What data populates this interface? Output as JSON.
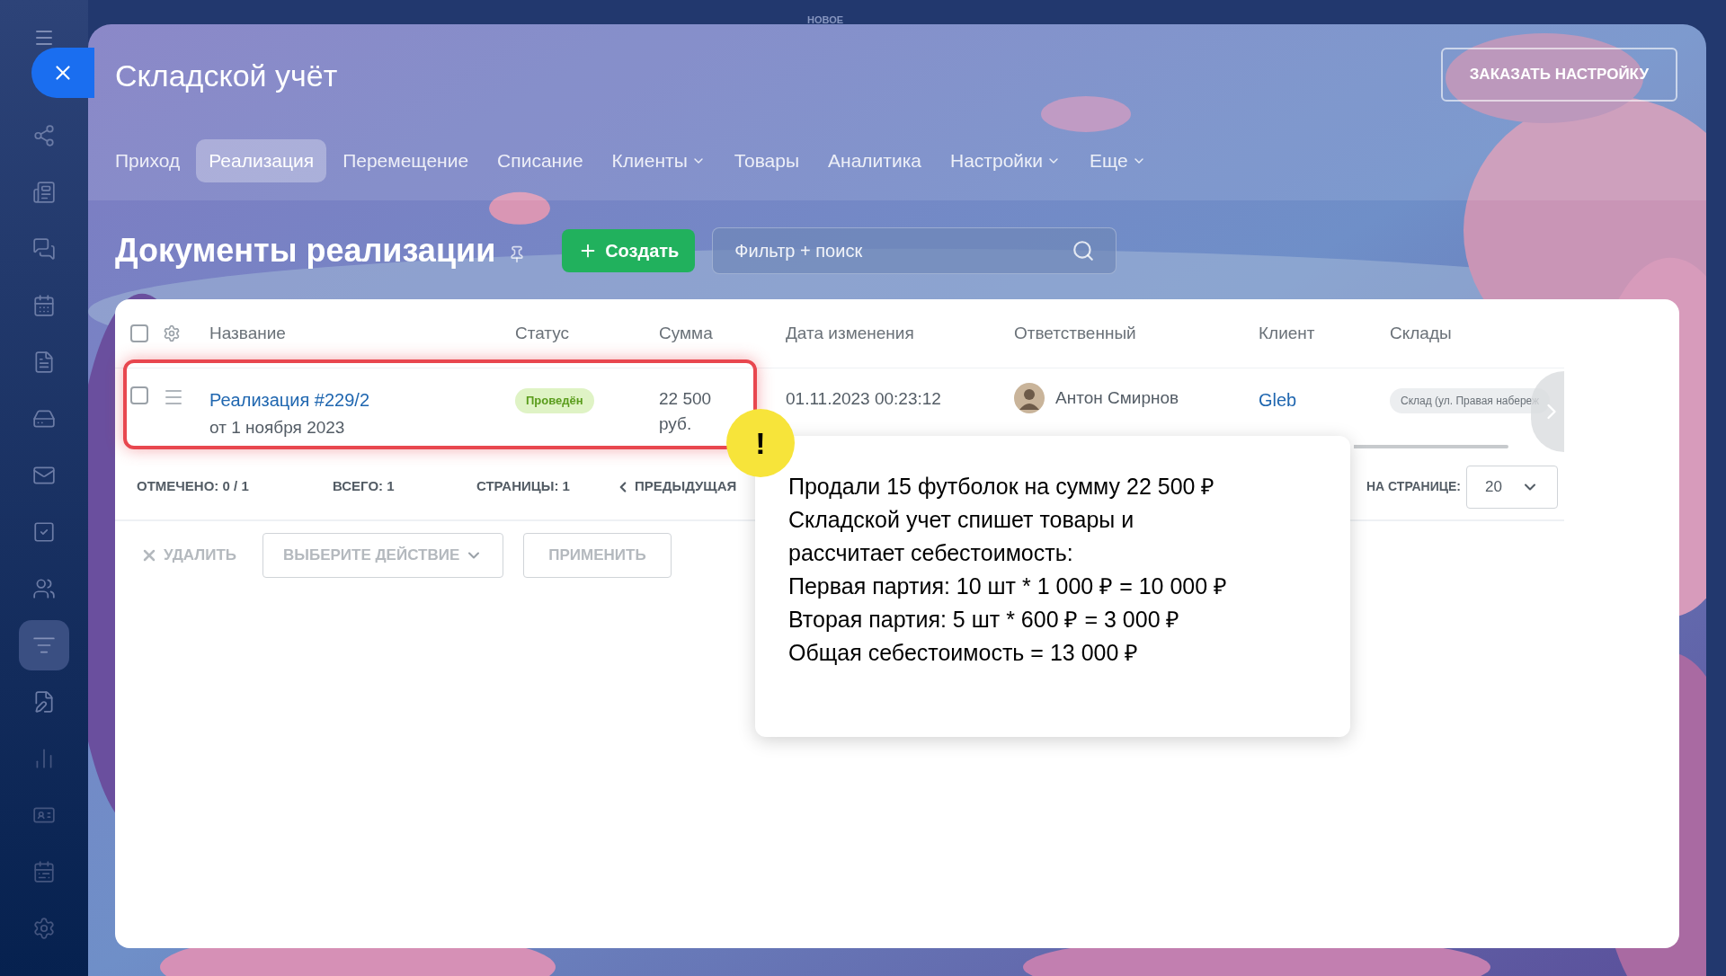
{
  "top_label": "НОВОЕ",
  "sidebar": {
    "items": [
      {
        "selected": false
      },
      {
        "selected": false
      },
      {
        "selected": false
      },
      {
        "selected": false
      },
      {
        "selected": false
      },
      {
        "selected": false
      },
      {
        "selected": false
      },
      {
        "selected": false
      },
      {
        "selected": false
      },
      {
        "selected": true
      },
      {
        "selected": false
      },
      {
        "selected": false
      },
      {
        "selected": false
      },
      {
        "selected": false
      },
      {
        "selected": false
      }
    ]
  },
  "window": {
    "title": "Складской учёт",
    "order_button": "ЗАКАЗАТЬ НАСТРОЙКУ"
  },
  "tabs": [
    {
      "label": "Приход",
      "selected": false,
      "has_menu": false
    },
    {
      "label": "Реализация",
      "selected": true,
      "has_menu": false
    },
    {
      "label": "Перемещение",
      "selected": false,
      "has_menu": false
    },
    {
      "label": "Списание",
      "selected": false,
      "has_menu": false
    },
    {
      "label": "Клиенты",
      "selected": false,
      "has_menu": true
    },
    {
      "label": "Товары",
      "selected": false,
      "has_menu": false
    },
    {
      "label": "Аналитика",
      "selected": false,
      "has_menu": false
    },
    {
      "label": "Настройки",
      "selected": false,
      "has_menu": true
    },
    {
      "label": "Еще",
      "selected": false,
      "has_menu": true
    }
  ],
  "page_heading": "Документы реализации",
  "create_button": "Создать",
  "search": {
    "placeholder": "Фильтр + поиск"
  },
  "table": {
    "all_checked": false,
    "columns": [
      "Название",
      "Статус",
      "Сумма",
      "Дата изменения",
      "Ответственный",
      "Клиент",
      "Склады"
    ],
    "rows": [
      {
        "checked": false,
        "name": "Реализация #229/2",
        "date_line": "от 1 ноября 2023",
        "status": "Проведён",
        "amount": "22 500 руб.",
        "modified": "01.11.2023 00:23:12",
        "responsible": "Антон Смирнов",
        "client": "Gleb",
        "warehouse": "Склад (ул. Правая набереж"
      }
    ]
  },
  "footer": {
    "checked_label": "ОТМЕЧЕНО:",
    "checked_value": "0 / 1",
    "total_label": "ВСЕГО:",
    "total_value": "1",
    "pages_label": "СТРАНИЦЫ:",
    "pages_value": "1",
    "prev": "ПРЕДЫДУЩАЯ",
    "per_page_label": "НА СТРАНИЦЕ:",
    "per_page": "20"
  },
  "actions": {
    "delete": "УДАЛИТЬ",
    "select_placeholder": "ВЫБЕРИТЕ ДЕЙСТВИЕ",
    "apply": "ПРИМЕНИТЬ"
  },
  "callout": {
    "mark": "!",
    "lines": [
      "Продали 15 футболок на сумму 22 500 ₽",
      "Складской учет спишет товары и",
      "рассчитает себестоимость:",
      "Первая партия: 10 шт * 1 000 ₽ = 10 000 ₽",
      "Вторая партия: 5 шт * 600 ₽ = 3 000 ₽",
      "Общая себестоимость = 13 000 ₽"
    ]
  }
}
